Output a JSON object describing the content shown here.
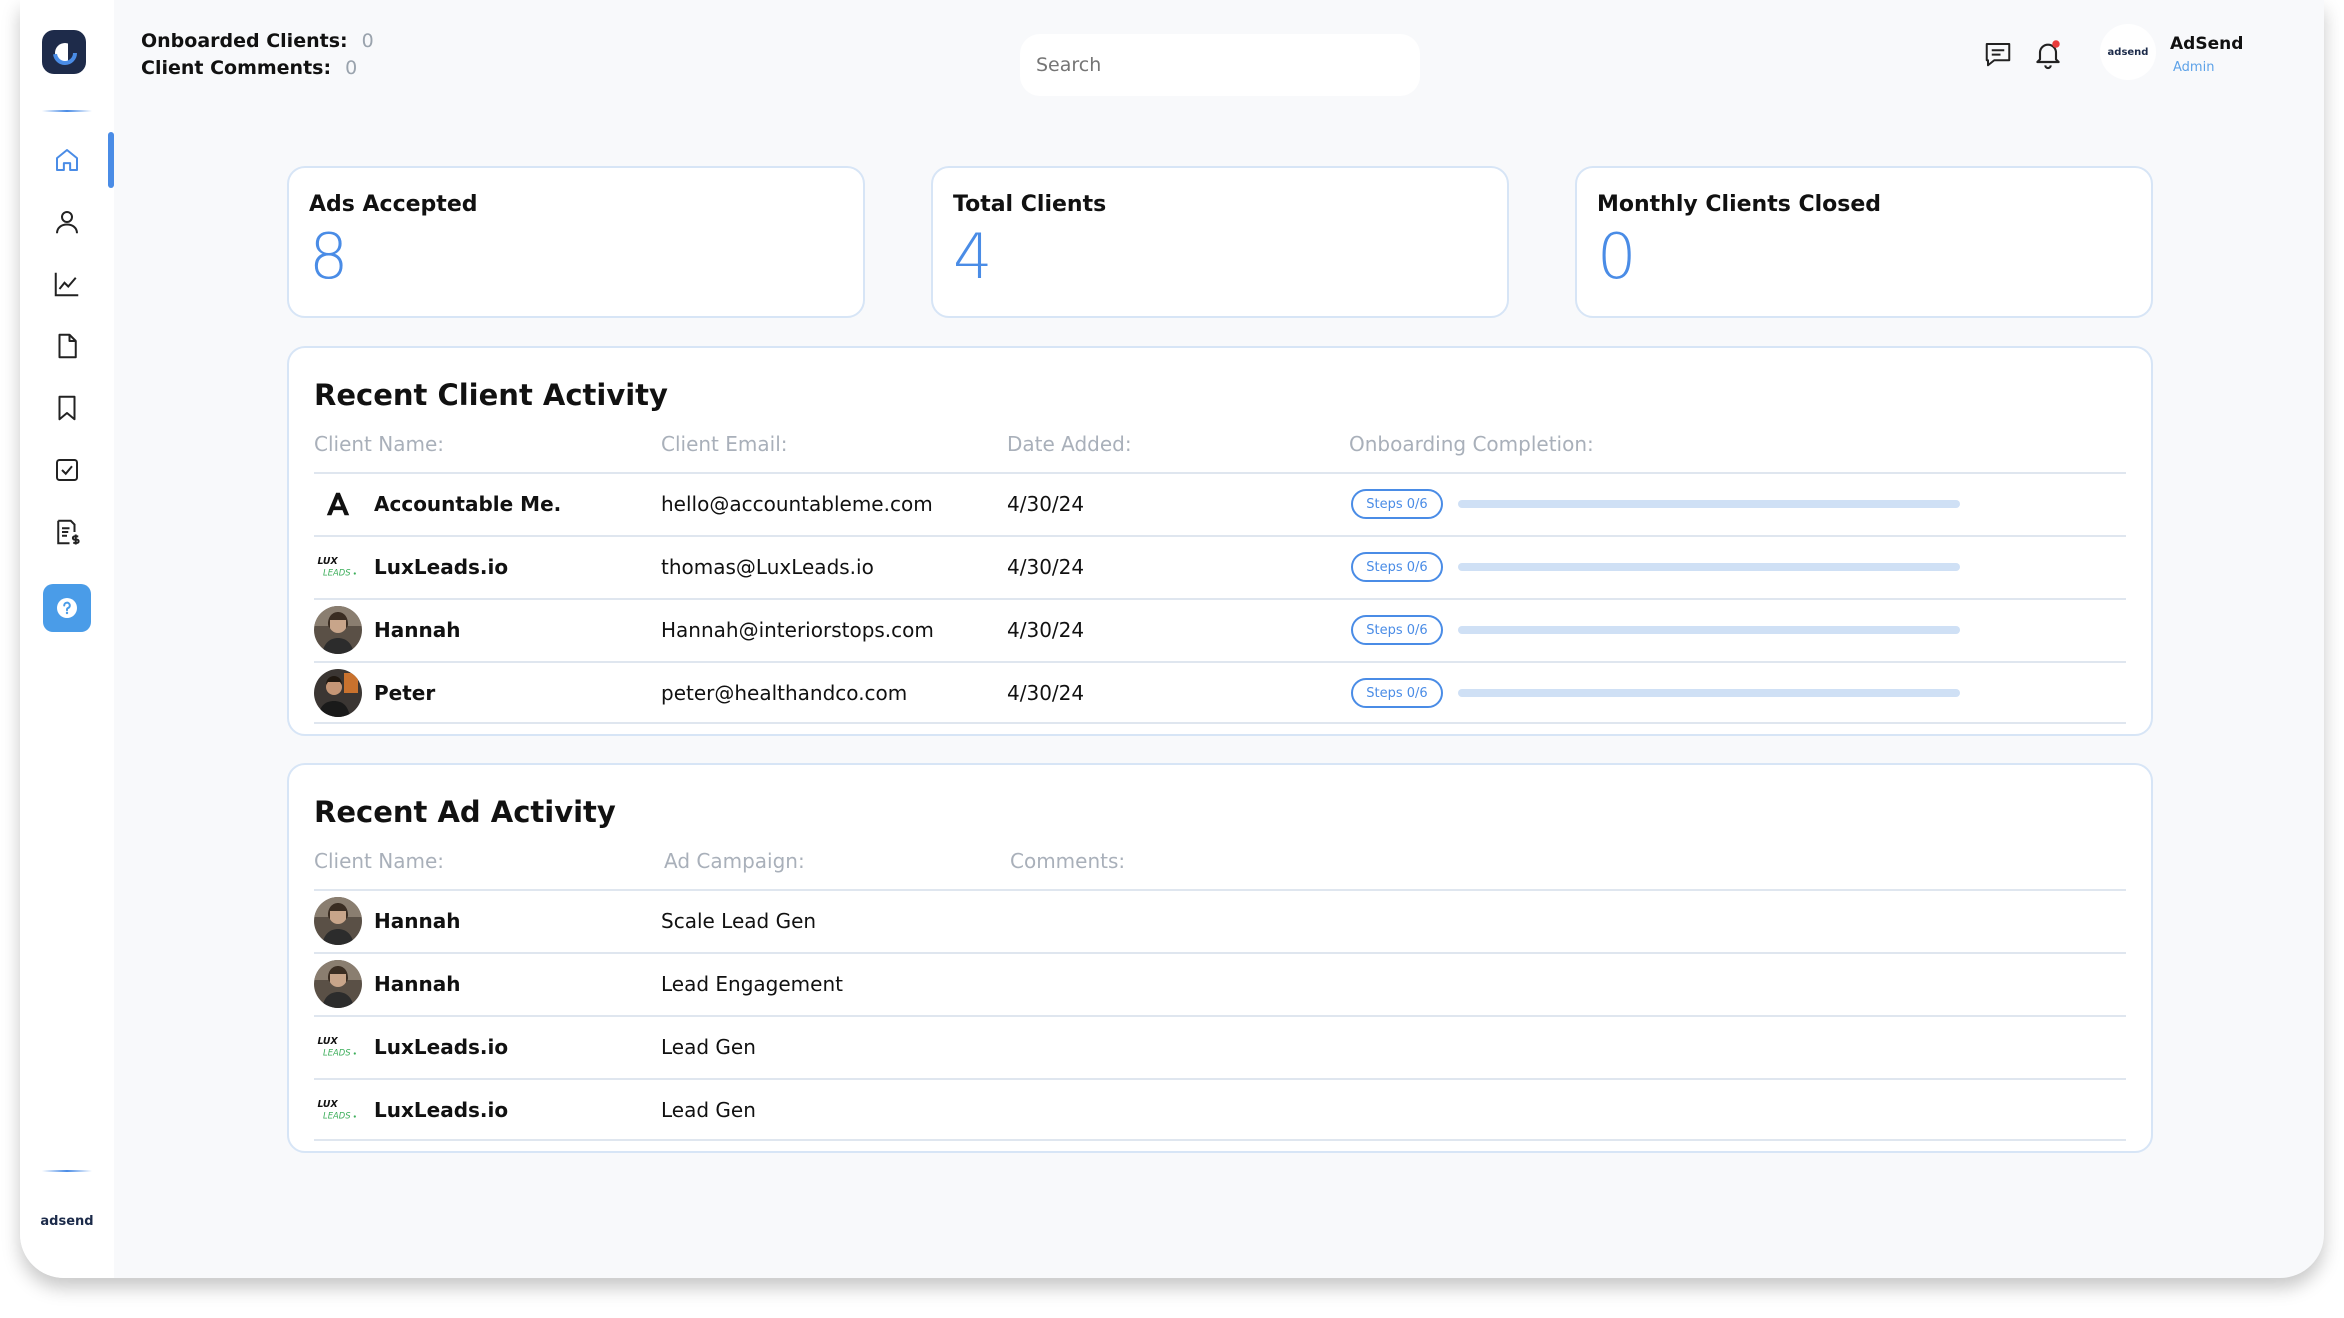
{
  "header": {
    "onboarded_label": "Onboarded Clients:",
    "onboarded_value": "0",
    "comments_label": "Client Comments:",
    "comments_value": "0",
    "search_placeholder": "Search",
    "user_name": "AdSend",
    "user_role": "Admin",
    "avatar_text": "adsend",
    "notification_dot_color": "#e83b3b"
  },
  "sidebar": {
    "items": [
      {
        "icon": "home-icon",
        "active": true
      },
      {
        "icon": "user-icon",
        "active": false
      },
      {
        "icon": "chart-line-icon",
        "active": false
      },
      {
        "icon": "document-icon",
        "active": false
      },
      {
        "icon": "bookmark-icon",
        "active": false
      },
      {
        "icon": "checkbox-icon",
        "active": false
      },
      {
        "icon": "invoice-icon",
        "active": false
      },
      {
        "icon": "help-icon",
        "active": false
      }
    ],
    "brand": "adsend"
  },
  "stats": [
    {
      "title": "Ads Accepted",
      "value": "8"
    },
    {
      "title": "Total Clients",
      "value": "4"
    },
    {
      "title": "Monthly Clients Closed",
      "value": "0"
    }
  ],
  "client_activity": {
    "title": "Recent Client Activity",
    "columns": [
      "Client Name:",
      "Client Email:",
      "Date Added:",
      "Onboarding Completion:"
    ],
    "rows": [
      {
        "logo": "accountable-logo",
        "name": "Accountable Me.",
        "email": "hello@accountableme.com",
        "date": "4/30/24",
        "steps": "Steps  0/6",
        "progress": 0
      },
      {
        "logo": "luxleads-logo",
        "name": "LuxLeads.io",
        "email": "thomas@LuxLeads.io",
        "date": "4/30/24",
        "steps": "Steps  0/6",
        "progress": 0
      },
      {
        "logo": "avatar-hannah",
        "name": "Hannah",
        "email": "Hannah@interiorstops.com",
        "date": "4/30/24",
        "steps": "Steps  0/6",
        "progress": 0
      },
      {
        "logo": "avatar-peter",
        "name": "Peter",
        "email": "peter@healthandco.com",
        "date": "4/30/24",
        "steps": "Steps  0/6",
        "progress": 0
      }
    ]
  },
  "ad_activity": {
    "title": "Recent Ad Activity",
    "columns": [
      "Client Name:",
      "Ad Campaign:",
      "Comments:"
    ],
    "rows": [
      {
        "logo": "avatar-hannah",
        "name": "Hannah",
        "campaign": "Scale Lead Gen"
      },
      {
        "logo": "avatar-hannah",
        "name": "Hannah",
        "campaign": "Lead Engagement"
      },
      {
        "logo": "luxleads-logo",
        "name": "LuxLeads.io",
        "campaign": "Lead Gen"
      },
      {
        "logo": "luxleads-logo",
        "name": "LuxLeads.io",
        "campaign": "Lead Gen"
      }
    ]
  },
  "colors": {
    "accent": "#4a8ce6",
    "border": "#d7e5f6",
    "muted": "#a9b0ba"
  }
}
